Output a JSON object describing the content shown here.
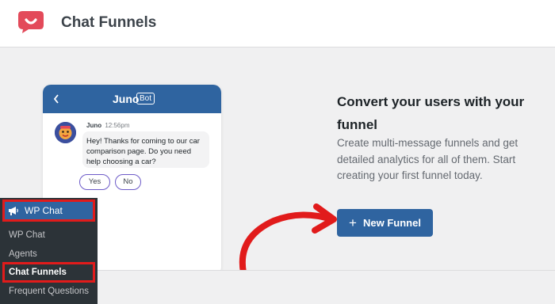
{
  "header": {
    "logo_icon": "chat-bubble-smile-icon",
    "title": "Chat Funnels"
  },
  "chat_preview": {
    "back_icon": "chevron-left-icon",
    "name": "Juno",
    "badge": "Bot",
    "message": {
      "author": "Juno",
      "time": "12:56pm",
      "text": "Hey! Thanks for coming to our car comparison page. Do you need help choosing a car?"
    },
    "quick_replies": [
      "Yes",
      "No"
    ]
  },
  "promo": {
    "title": "Convert your users with your funnel",
    "description": "Create multi-message funnels and get detailed analytics for all of them. Start creating your first funnel today.",
    "button_label": "New Funnel",
    "button_icon": "plus-icon"
  },
  "wp_menu": {
    "top_label": "WP Chat",
    "top_icon": "megaphone-icon",
    "items": [
      {
        "label": "WP Chat"
      },
      {
        "label": "Agents"
      },
      {
        "label": "Chat Funnels"
      },
      {
        "label": "Frequent Questions"
      }
    ]
  },
  "colors": {
    "accent": "#2f64a0",
    "logo": "#e34a5a",
    "highlight_border": "#e11b1b",
    "wp_sidebar": "#2c3338"
  }
}
